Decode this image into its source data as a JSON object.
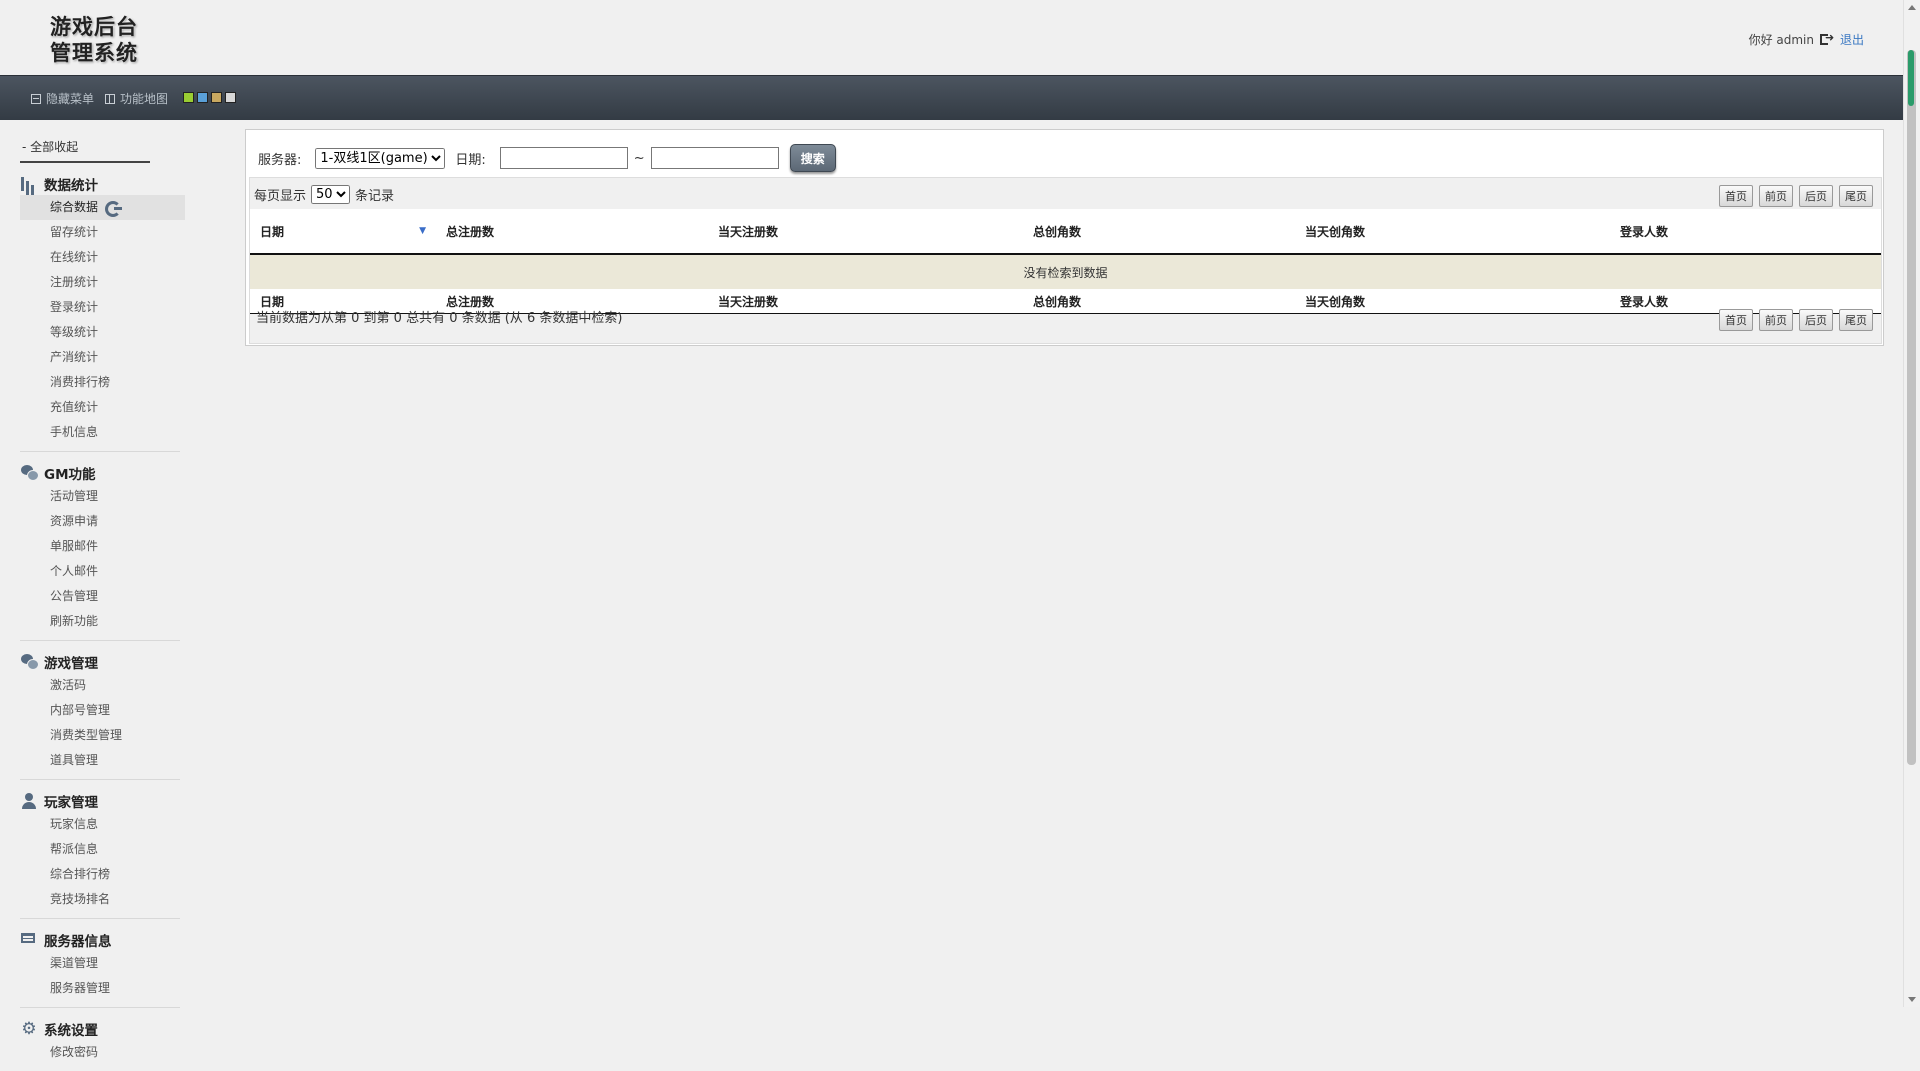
{
  "header": {
    "logo_line1": "游戏后台",
    "logo_line2": "管理系统",
    "greeting": "你好 admin",
    "logout": "退出"
  },
  "navbar": {
    "hide_menu": "隐藏菜单",
    "function_map": "功能地图",
    "skin_colors": [
      "#9acd32",
      "#5aa0d8",
      "#c8a860",
      "#d8d8d8"
    ]
  },
  "sidebar": {
    "collapse_all": "- 全部收起",
    "groups": [
      {
        "title": "数据统计",
        "icon": "bar-chart-icon",
        "items": [
          "综合数据",
          "留存统计",
          "在线统计",
          "注册统计",
          "登录统计",
          "等级统计",
          "产消统计",
          "消费排行榜",
          "充值统计",
          "手机信息"
        ]
      },
      {
        "title": "GM功能",
        "icon": "chat-bubbles-icon",
        "items": [
          "活动管理",
          "资源申请",
          "单服邮件",
          "个人邮件",
          "公告管理",
          "刷新功能"
        ]
      },
      {
        "title": "游戏管理",
        "icon": "chat-bubbles-icon",
        "items": [
          "激活码",
          "内部号管理",
          "消费类型管理",
          "道具管理"
        ]
      },
      {
        "title": "玩家管理",
        "icon": "user-icon",
        "items": [
          "玩家信息",
          "帮派信息",
          "综合排行榜",
          "竞技场排名"
        ]
      },
      {
        "title": "服务器信息",
        "icon": "server-icon",
        "items": [
          "渠道管理",
          "服务器管理"
        ]
      },
      {
        "title": "系统设置",
        "icon": "gear-icon",
        "items": [
          "修改密码"
        ]
      }
    ]
  },
  "filter": {
    "server_label": "服务器:",
    "server_selected": "1-双线1区(game)",
    "date_label": "日期:",
    "date_from": "",
    "date_to": "",
    "tilde": "~",
    "search_button": "搜索"
  },
  "table": {
    "length_prefix": "每页显示",
    "length_value": "50",
    "length_suffix": "条记录",
    "pager": {
      "first": "首页",
      "prev": "前页",
      "next": "后页",
      "last": "尾页"
    },
    "columns": [
      "日期",
      "总注册数",
      "当天注册数",
      "总创角数",
      "当天创角数",
      "登录人数"
    ],
    "empty_text": "没有检索到数据",
    "info": "当前数据为从第 0 到第 0 总共有 0 条数据 (从 6 条数据中检索)"
  }
}
